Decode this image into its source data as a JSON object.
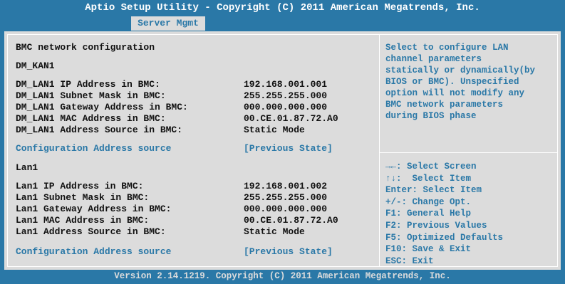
{
  "header": {
    "title": "Aptio Setup Utility - Copyright (C) 2011 American Megatrends, Inc.",
    "active_tab": "Server Mgmt"
  },
  "main": {
    "section_title": "BMC network configuration",
    "dm_kan1": {
      "heading": "DM_KAN1",
      "rows": [
        {
          "label": "DM_LAN1 IP Address in BMC:",
          "value": "192.168.001.001"
        },
        {
          "label": "DM_LAN1 Subnet Mask in BMC:",
          "value": "255.255.255.000"
        },
        {
          "label": "DM_LAN1 Gateway Address in BMC:",
          "value": "000.000.000.000"
        },
        {
          "label": "DM_LAN1 MAC Address in BMC:",
          "value": "00.CE.01.87.72.A0"
        },
        {
          "label": "DM_LAN1 Address Source in BMC:",
          "value": "Static Mode"
        }
      ],
      "config_label": "Configuration Address source",
      "config_value": "[Previous State]"
    },
    "lan1": {
      "heading": "Lan1",
      "rows": [
        {
          "label": "Lan1 IP Address in BMC:",
          "value": "192.168.001.002"
        },
        {
          "label": "Lan1 Subnet Mask in BMC:",
          "value": "255.255.255.000"
        },
        {
          "label": "Lan1 Gateway Address in BMC:",
          "value": "000.000.000.000"
        },
        {
          "label": "Lan1 MAC Address in BMC:",
          "value": "00.CE.01.87.72.A0"
        },
        {
          "label": "Lan1 Address Source in BMC:",
          "value": "Static Mode"
        }
      ],
      "config_label": "Configuration Address source",
      "config_value": "[Previous State]"
    }
  },
  "help": {
    "lines": [
      "Select to configure LAN",
      "channel parameters",
      "statically or dynamically(by",
      "BIOS or BMC). Unspecified",
      "option will not modify any",
      "BMC network parameters",
      "during BIOS phase"
    ]
  },
  "keys": [
    "→←: Select Screen",
    "↑↓:  Select Item",
    "Enter: Select Item",
    "+/-: Change Opt.",
    "F1: General Help",
    "F2: Previous Values",
    "F5: Optimized Defaults",
    "F10: Save & Exit",
    "ESC: Exit"
  ],
  "footer": {
    "text": "Version 2.14.1219. Copyright (C) 2011 American Megatrends, Inc."
  },
  "colors": {
    "frame_blue": "#2a78a7",
    "panel_gray": "#dcdcdc",
    "text_dark": "#111111"
  }
}
